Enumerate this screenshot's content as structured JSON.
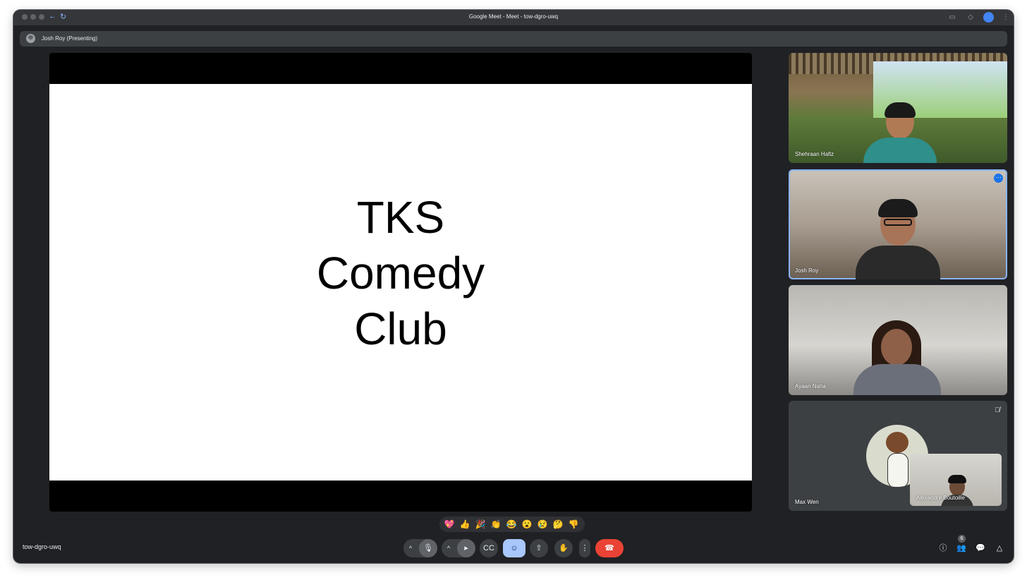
{
  "browser": {
    "tab_title": "Google Meet - Meet - tow-dgro-uwq",
    "nav_back": "←",
    "nav_reload": "↻"
  },
  "presenter_bar": {
    "label": "Josh Roy (Presenting)"
  },
  "slide": {
    "lines": [
      "TKS",
      "Comedy",
      "Club"
    ]
  },
  "participants": [
    {
      "name": "Shehraan Hafiz"
    },
    {
      "name": "Josh Roy"
    },
    {
      "name": "Ayaan Naha"
    },
    {
      "name": "Max Wen"
    },
    {
      "name": "Alexandre Boutoille"
    }
  ],
  "reactions": [
    "💖",
    "👍",
    "🎉",
    "👏",
    "😂",
    "😮",
    "😢",
    "🤔",
    "👎"
  ],
  "meeting_code": "tow-dgro-uwq",
  "people_count": "6",
  "icons": {
    "mic": "mic-icon",
    "camera": "camera-icon",
    "captions": "captions-icon",
    "emoji": "emoji-icon",
    "present": "present-icon",
    "hand": "raise-hand-icon",
    "more": "more-options-icon",
    "end": "end-call-icon"
  },
  "colors": {
    "background": "#202124",
    "surface": "#3c4043",
    "accent": "#a8c7fa",
    "end_call": "#ea4335",
    "active_border": "#8ab4f8"
  }
}
